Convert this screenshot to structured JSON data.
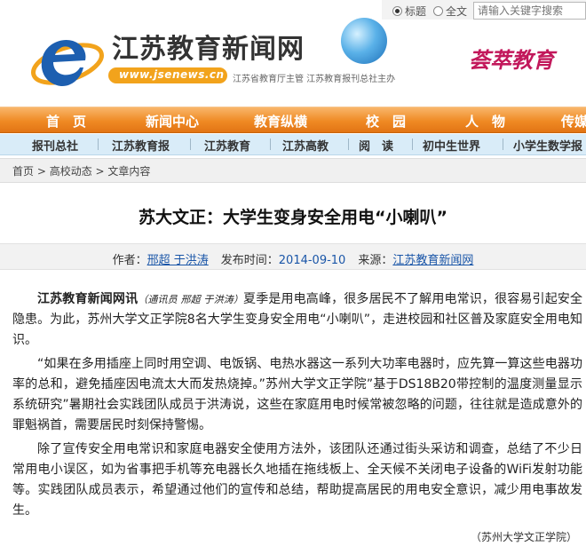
{
  "search": {
    "option_title": "标题",
    "option_fulltext": "全文",
    "placeholder": "请输入关键字搜索"
  },
  "header": {
    "site_title": "江苏教育新闻网",
    "url": "www.jsenews.cn",
    "subtitle": "江苏省教育厅主管  江苏教育报刊总社主办",
    "banner": "荟萃教育"
  },
  "nav": {
    "main": [
      "首　页",
      "新闻中心",
      "教育纵横",
      "校　园",
      "人　物",
      "传媒"
    ],
    "sub": [
      "报刊总社",
      "江苏教育报",
      "江苏教育",
      "江苏高教",
      "阅　读",
      "初中生世界",
      "小学生数学报"
    ]
  },
  "breadcrumb": {
    "home": "首页",
    "sep1": " > ",
    "section": "高校动态",
    "sep2": " > ",
    "current": "文章内容"
  },
  "article": {
    "title": "苏大文正：大学生变身安全用电“小喇叭”",
    "author_label": "作者：",
    "author": "邢超 于洪涛",
    "date_label": "发布时间：",
    "date": "2014-09-10",
    "source_label": "来源：",
    "source": "江苏教育新闻网",
    "lead": "江苏教育新闻网讯",
    "byline": "（通讯员 邢超 于洪涛）",
    "p1_rest": "夏季是用电高峰，很多居民不了解用电常识，很容易引起安全隐患。为此，苏州大学文正学院8名大学生变身安全用电“小喇叭”，走进校园和社区普及家庭安全用电知识。",
    "p2": "“如果在多用插座上同时用空调、电饭锅、电热水器这一系列大功率电器时，应先算一算这些电器功率的总和，避免插座因电流太大而发热烧掉。”苏州大学文正学院”基于DS18B20带控制的温度测量显示系统研究”暑期社会实践团队成员于洪涛说，这些在家庭用电时候常被忽略的问题，往往就是造成意外的罪魁祸首，需要居民时刻保持警惕。",
    "p3": "除了宣传安全用电常识和家庭电器安全使用方法外，该团队还通过街头采访和调查，总结了不少日常用电小误区，如为省事把手机等充电器长久地插在拖线板上、全天候不关闭电子设备的WiFi发射功能等。实践团队成员表示，希望通过他们的宣传和总结，帮助提高居民的用电安全意识，减少用电事故发生。",
    "source_footer": "（苏州大学文正学院）"
  },
  "colors": {
    "nav_orange": "#ef8a24",
    "nav_sub_blue": "#d9ecf8",
    "link_blue": "#1a56a8",
    "logo_blue": "#1d5fb0",
    "logo_orange": "#f2a31c",
    "banner_magenta": "#c2185b"
  }
}
